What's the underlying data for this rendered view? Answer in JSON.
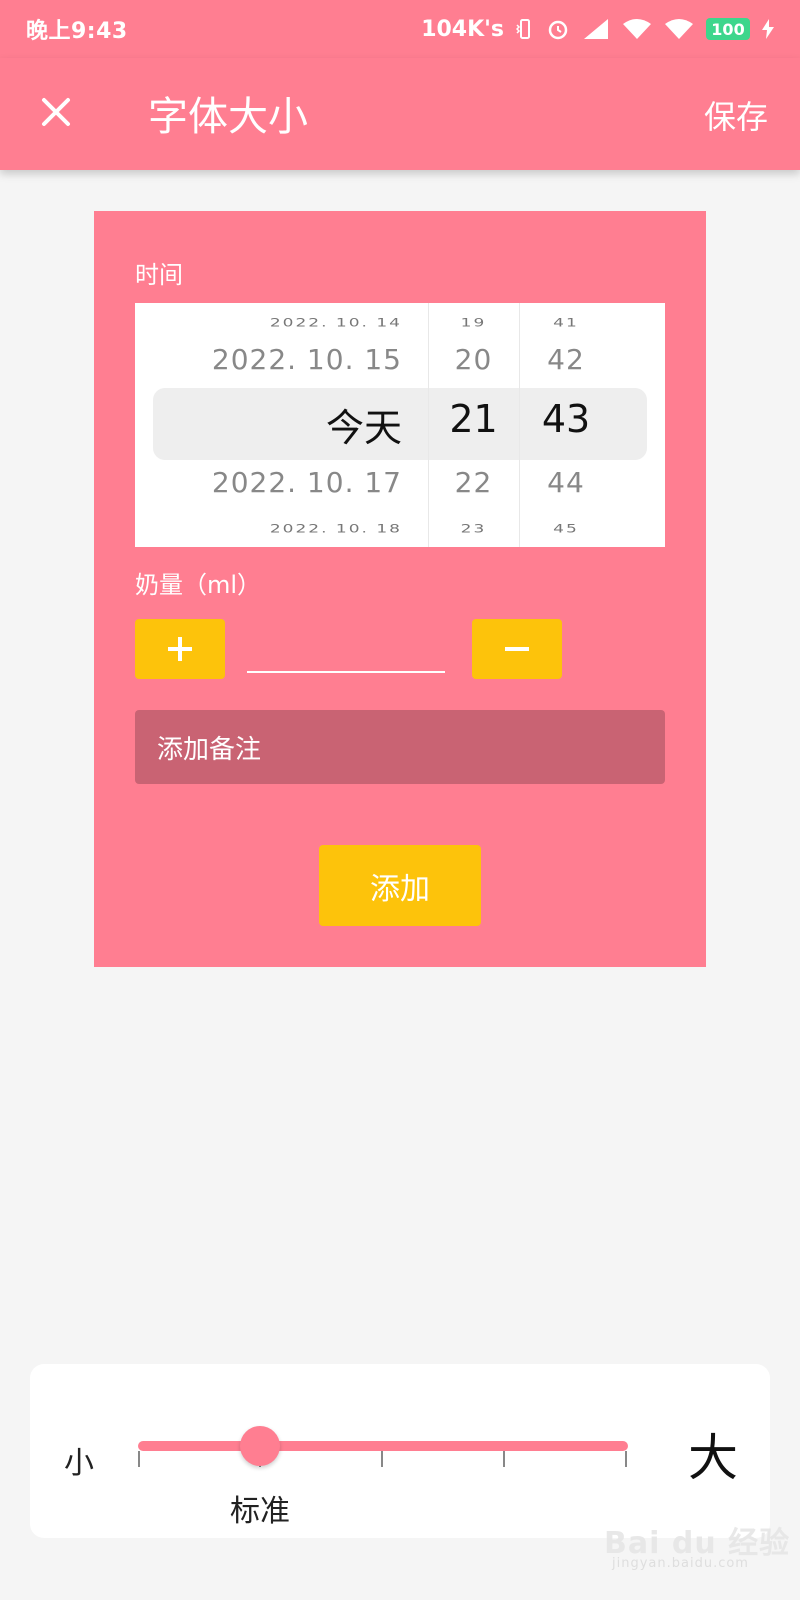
{
  "status_bar": {
    "time": "晚上9:43",
    "network_speed": "104K's",
    "battery": "100"
  },
  "app_bar": {
    "title": "字体大小",
    "save_label": "保存",
    "close_icon": "close-icon"
  },
  "card": {
    "time_label": "时间",
    "time_picker": {
      "dates": [
        "2022. 10. 14",
        "2022. 10. 15",
        "今天",
        "2022. 10. 17",
        "2022. 10. 18"
      ],
      "hours": [
        "19",
        "20",
        "21",
        "22",
        "23"
      ],
      "minutes": [
        "41",
        "42",
        "43",
        "44",
        "45"
      ],
      "selected": {
        "date": "今天",
        "hour": "21",
        "minute": "43"
      }
    },
    "milk_label": "奶量（ml）",
    "milk_value": "",
    "plus_label": "+",
    "minus_label": "−",
    "note_placeholder": "添加备注",
    "add_label": "添加"
  },
  "font_size": {
    "small_label": "小",
    "large_label": "大",
    "current_label": "标准",
    "level_index": 1,
    "levels": 5
  },
  "colors": {
    "primary": "#ff7e91",
    "accent": "#fdc30b",
    "note_bg": "#c96373",
    "background": "#f5f5f5"
  },
  "watermark": {
    "text": "Bai du 经验",
    "sub": "jingyan.baidu.com"
  }
}
